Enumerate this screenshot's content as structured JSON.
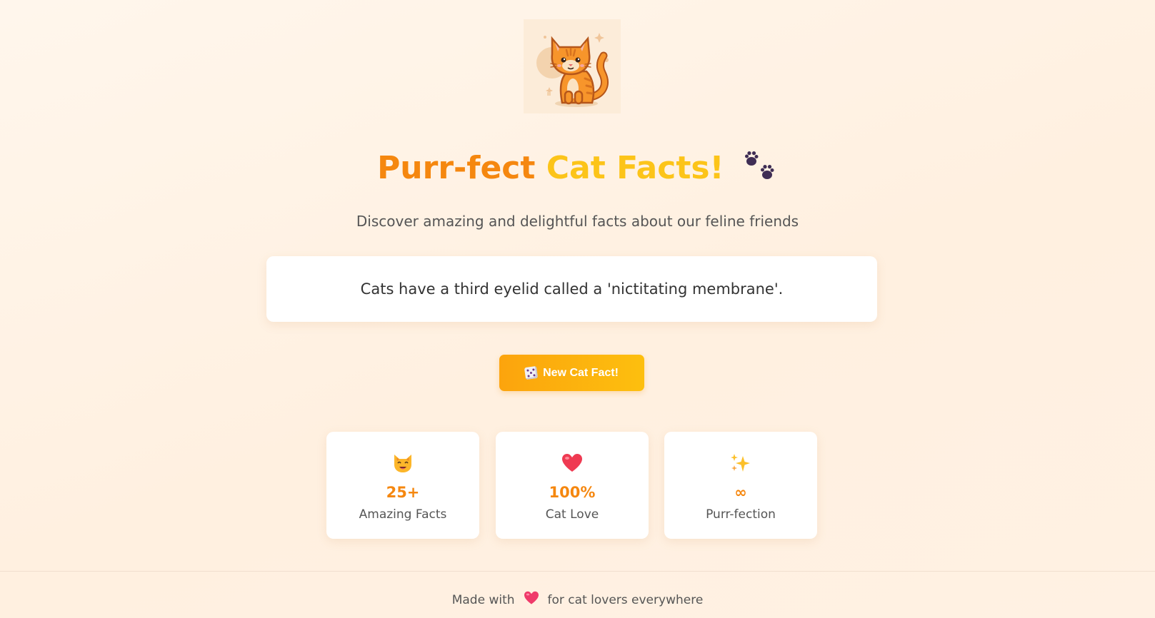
{
  "logo": {
    "icon": "cat-illustration"
  },
  "title": {
    "part1": "Purr-fect",
    "part2": "Cat Facts!",
    "icon": "paw-prints-icon"
  },
  "subtitle": "Discover amazing and delightful facts about our feline friends",
  "fact": {
    "text": "Cats have a third eyelid called a 'nictitating membrane'."
  },
  "button": {
    "label": "New Cat Fact!",
    "icon": "dice-icon"
  },
  "stats": [
    {
      "icon": "cat-face-icon",
      "value": "25+",
      "label": "Amazing Facts"
    },
    {
      "icon": "heart-icon",
      "value": "100%",
      "label": "Cat Love"
    },
    {
      "icon": "sparkles-icon",
      "value": "∞",
      "label": "Purr-fection"
    }
  ],
  "footer": {
    "before": "Made with",
    "icon": "heart-icon",
    "after": "for cat lovers everywhere"
  },
  "colors": {
    "accent_orange": "#f5870f",
    "accent_yellow": "#fcc419",
    "button_start": "#fca40d",
    "button_end": "#fdbf0e"
  }
}
